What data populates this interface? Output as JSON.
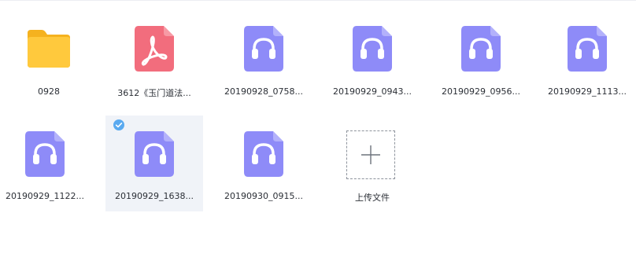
{
  "files": [
    {
      "name": "0928",
      "type": "folder",
      "icon": "folder-icon",
      "selected": false
    },
    {
      "name": "3612《玉门道法...",
      "type": "pdf",
      "icon": "pdf-icon",
      "selected": false
    },
    {
      "name": "20190928_0758...",
      "type": "audio",
      "icon": "audio-file-icon",
      "selected": false
    },
    {
      "name": "20190929_0943...",
      "type": "audio",
      "icon": "audio-file-icon",
      "selected": false
    },
    {
      "name": "20190929_0956...",
      "type": "audio",
      "icon": "audio-file-icon",
      "selected": false
    },
    {
      "name": "20190929_1113...",
      "type": "audio",
      "icon": "audio-file-icon",
      "selected": false
    },
    {
      "name": "20190929_1122...",
      "type": "audio",
      "icon": "audio-file-icon",
      "selected": false
    },
    {
      "name": "20190929_1638...",
      "type": "audio",
      "icon": "audio-file-icon",
      "selected": true
    },
    {
      "name": "20190930_0915...",
      "type": "audio",
      "icon": "audio-file-icon",
      "selected": false
    }
  ],
  "upload": {
    "label": "上传文件",
    "icon": "plus-icon"
  },
  "colors": {
    "folder": "#ffc93d",
    "folder_tab": "#f5b21f",
    "pdf": "#f26d7d",
    "audio": "#8e8bf8",
    "audio_fold": "#b3b1fb",
    "selected_bg": "#f0f3f8",
    "check": "#5aaaf0"
  }
}
